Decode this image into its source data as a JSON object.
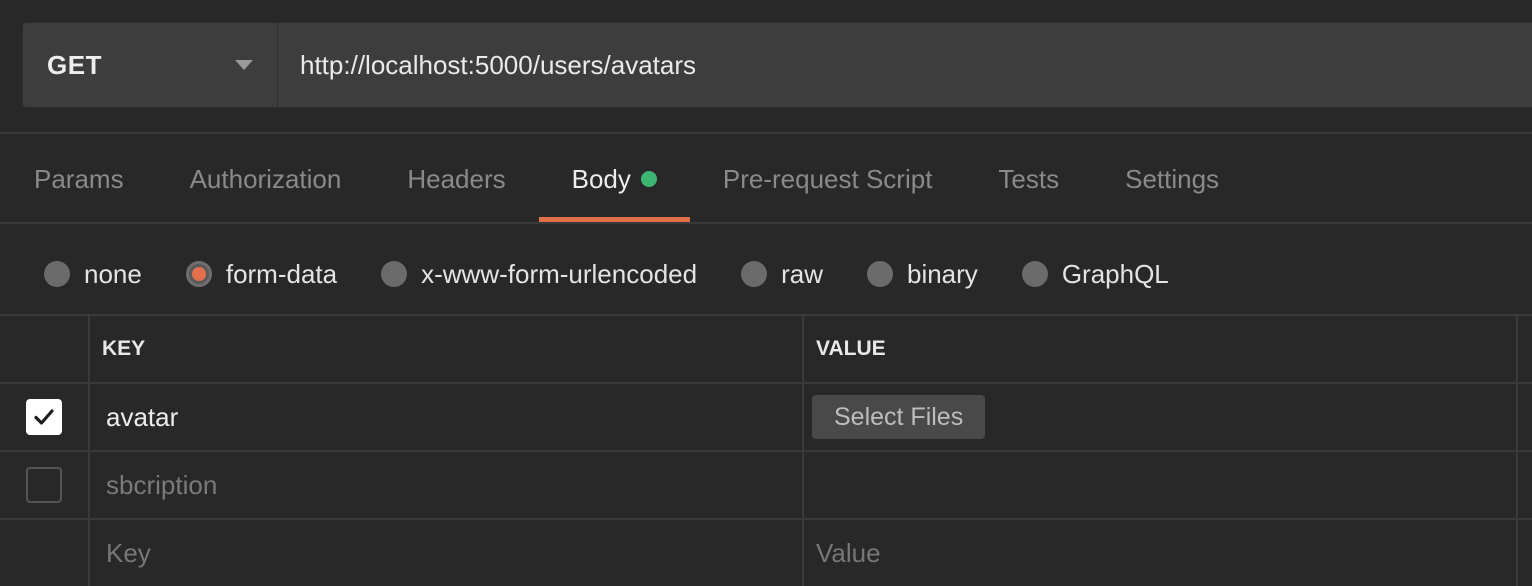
{
  "request": {
    "method": "GET",
    "url": "http://localhost:5000/users/avatars"
  },
  "tabs": [
    {
      "label": "Params",
      "active": false
    },
    {
      "label": "Authorization",
      "active": false
    },
    {
      "label": "Headers",
      "active": false
    },
    {
      "label": "Body",
      "active": true,
      "indicator_color": "#3fb573"
    },
    {
      "label": "Pre-request Script",
      "active": false
    },
    {
      "label": "Tests",
      "active": false
    },
    {
      "label": "Settings",
      "active": false
    }
  ],
  "body_types": [
    {
      "label": "none",
      "selected": false
    },
    {
      "label": "form-data",
      "selected": true
    },
    {
      "label": "x-www-form-urlencoded",
      "selected": false
    },
    {
      "label": "raw",
      "selected": false
    },
    {
      "label": "binary",
      "selected": false
    },
    {
      "label": "GraphQL",
      "selected": false
    }
  ],
  "table": {
    "headers": {
      "key": "KEY",
      "value": "VALUE"
    },
    "rows": [
      {
        "checked": true,
        "key": "avatar",
        "value_button": "Select Files"
      },
      {
        "checked": false,
        "key": "sbcription",
        "value_button": ""
      }
    ],
    "new_row": {
      "key_placeholder": "Key",
      "value_placeholder": "Value"
    }
  },
  "colors": {
    "accent": "#e0704a",
    "background": "#282828",
    "indicator": "#3fb573"
  },
  "icons": {
    "method_dropdown": "chevron-down-icon",
    "checkbox_checked": "checkmark-icon"
  }
}
